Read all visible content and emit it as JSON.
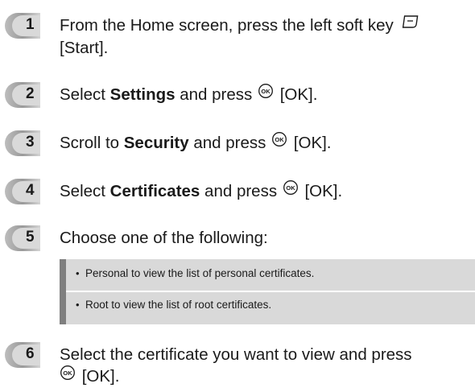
{
  "steps": [
    {
      "number": "1",
      "line1_prefix": "From the Home screen, press the left soft key",
      "line2": "[Start]."
    },
    {
      "number": "2",
      "prefix": "Select ",
      "bold": "Settings",
      "middle": " and press",
      "suffix": "[OK]."
    },
    {
      "number": "3",
      "prefix": "Scroll to ",
      "bold": "Security",
      "middle": " and press",
      "suffix": "[OK]."
    },
    {
      "number": "4",
      "prefix": "Select ",
      "bold": "Certificates",
      "middle": " and press",
      "suffix": "[OK]."
    },
    {
      "number": "5",
      "text": "Choose one of the following:"
    },
    {
      "number": "6",
      "line1": "Select the certificate you want to view and press",
      "line2_suffix": "[OK]."
    }
  ],
  "options": [
    {
      "bullet": "•",
      "text": "Personal to view the list of personal certificates."
    },
    {
      "bullet": "•",
      "text": "Root to view the list of root certificates."
    }
  ],
  "icons": {
    "soft_key": "left-soft-key-icon",
    "ok_key": "ok-key-icon"
  },
  "colors": {
    "badge_gray": "#9a9a9a",
    "badge_light": "#d4d4d4",
    "options_bg": "#d9d9d9",
    "options_bar": "#7f7f7f"
  }
}
